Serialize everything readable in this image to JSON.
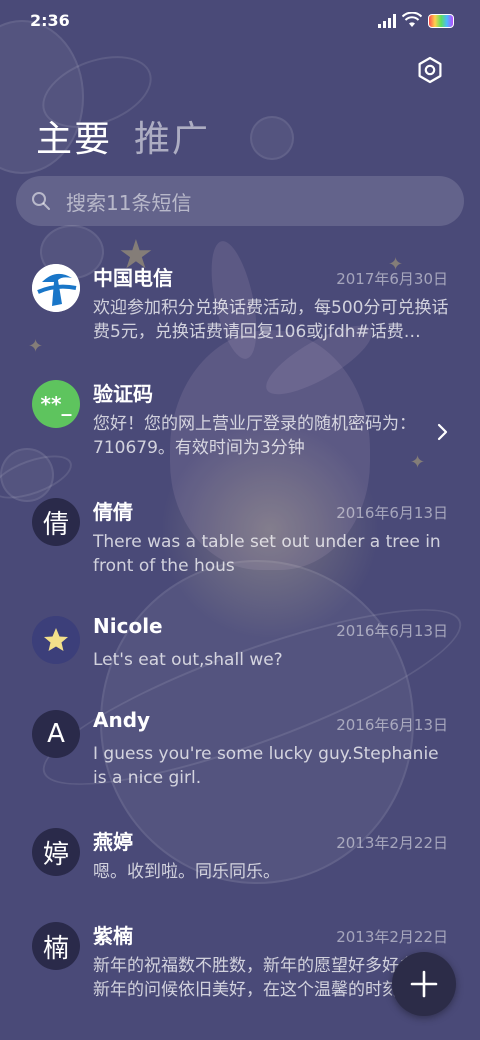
{
  "status_bar": {
    "time": "2:36"
  },
  "tabs": [
    {
      "label": "主要",
      "active": true
    },
    {
      "label": "推广",
      "active": false
    }
  ],
  "search": {
    "placeholder": "搜索11条短信"
  },
  "conversations": [
    {
      "name": "中国电信",
      "date": "2017年6月30日",
      "preview": "欢迎参加积分兑换话费活动，每500分可兑换话费5元，兑换话费请回复106或jfdh#话费…",
      "avatar": "telecom-logo"
    },
    {
      "name": "验证码",
      "date": "",
      "preview": "您好！您的网上营业厅登录的随机密码为：710679。有效时间为3分钟",
      "avatar": "**_"
    },
    {
      "name": "倩倩",
      "date": "2016年6月13日",
      "preview": "There was a table set out under a tree in front of the hous",
      "avatar": "倩"
    },
    {
      "name": "Nicole",
      "date": "2016年6月13日",
      "preview": "Let's eat out,shall we?",
      "avatar": "star-photo"
    },
    {
      "name": "Andy",
      "date": "2016年6月13日",
      "preview": "I guess you're some lucky guy.Stephanie is a nice girl.",
      "avatar": "A"
    },
    {
      "name": "燕婷",
      "date": "2013年2月22日",
      "preview": "嗯。收到啦。同乐同乐。",
      "avatar": "婷"
    },
    {
      "name": "紫楠",
      "date": "2013年2月22日",
      "preview": "新年的祝福数不胜数，新年的愿望好多好多，新年的问候依旧美好，在这个温馨的时刻",
      "avatar": "楠"
    }
  ],
  "colors": {
    "background": "#4a4a78",
    "verification_avatar": "#5ec45e",
    "telecom_blue": "#1976c8"
  }
}
